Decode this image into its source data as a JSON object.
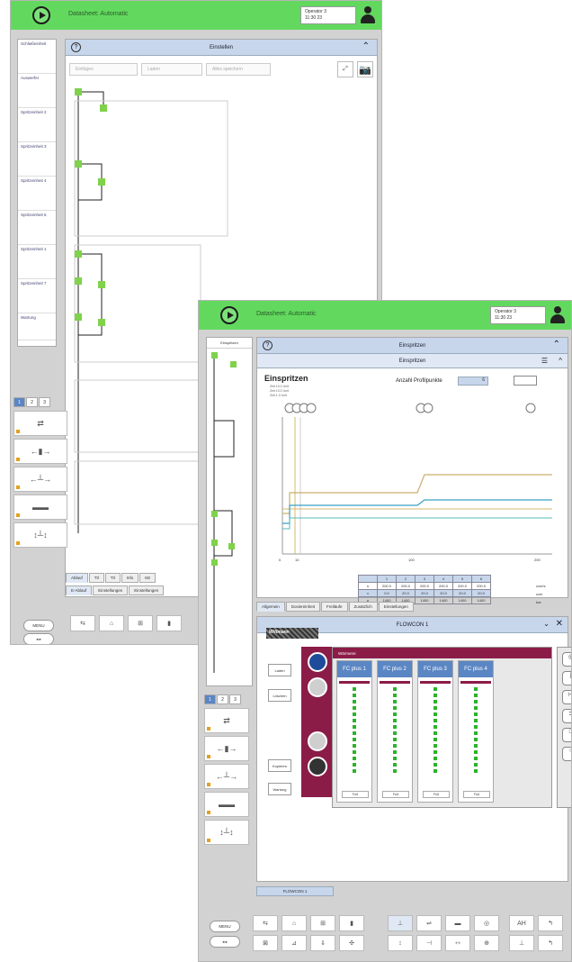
{
  "window1": {
    "title": "Datasheet: Automatic",
    "user_line1": "Operator 3",
    "user_line2": "11:30 23",
    "panel_title": "Einstellen",
    "toolbar": {
      "select_label": "Einfügen",
      "btn1": "Laden",
      "btn2": "Alles speichern"
    },
    "sidebar_items": [
      "Schließeinheit",
      "Auswerfer",
      "Spritzeinheit 2",
      "Spritzeinheit 3",
      "Spritzeinheit 4",
      "Spritzeinheit 5",
      "Spritzeinheit 1",
      "Spritzeinheit 7",
      "Wartung"
    ],
    "tabs": [
      "Ablauf",
      "Ttl",
      "Ttl",
      "Info",
      "Mz"
    ],
    "subtabs": [
      "E-Ablauf",
      "Einstellungen",
      "Einstellungen"
    ],
    "num_tabs": [
      "1",
      "2",
      "3"
    ],
    "menu_pill": "MENU",
    "nav_pill": "◂  ▸"
  },
  "window2": {
    "title": "Datasheet: Automatic",
    "user_line1": "Operator 3",
    "user_line2": "11:30 23",
    "left_label": "Einspritzen",
    "panel_title": "Einspritzen",
    "sub_title": "Einspritzen",
    "inj_title": "Einspritzen",
    "inj_sub": [
      "Zeit    10.0  Unit",
      "Zeit    10.0  Unit",
      "Zeit    1.0   Unit"
    ],
    "anzahl_label": "Anzahl Profilpunkte",
    "anzahl_value": "6",
    "table": {
      "header": [
        "",
        "1",
        "2",
        "3",
        "4",
        "5",
        "6"
      ],
      "rows": [
        [
          "s",
          "200.0",
          "200.0",
          "200.0",
          "200.0",
          "200.0",
          "200.0"
        ],
        [
          "v",
          "0.0",
          "20.0",
          "20.0",
          "20.0",
          "20.0",
          "20.0"
        ],
        [
          "p",
          "1400",
          "1400",
          "1400",
          "1400",
          "1400",
          "1400"
        ]
      ],
      "units": [
        "ccm/s",
        "ccm",
        "bar"
      ]
    },
    "bottom_tabs": [
      "Allgemein",
      "Dosiereinheit",
      "Freiläufe",
      "Zusätzlich",
      "Einstellungen"
    ],
    "flow_panel_title": "FLOWCON 1",
    "flow_brand": "Wittmann",
    "flow_buttons": [
      "Laden",
      "Löschen",
      "Kopieren",
      "Wartung"
    ],
    "flow_head": "Wärmerei",
    "flow_columns": [
      "FC plus 1",
      "FC plus 2",
      "FC plus 3",
      "FC plus 4"
    ],
    "flow_col_button": "Fuß",
    "flow_bottom_tab": "FLOWCON 1",
    "menu_pill": "MENU",
    "nav_pill": "◂  ▸",
    "mode_buttons": [
      "A",
      "H"
    ]
  }
}
